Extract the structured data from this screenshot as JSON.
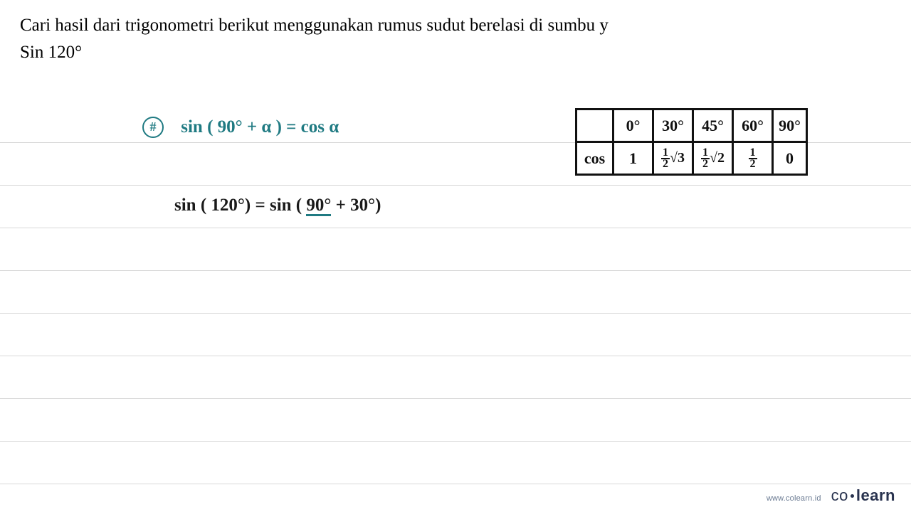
{
  "question": {
    "line1": "Cari hasil dari trigonometri berikut menggunakan rumus sudut berelasi di sumbu y",
    "line2": "Sin 120°"
  },
  "formula": {
    "marker": "#",
    "text": "sin  ( 90° + α )  =  cos  α"
  },
  "calculation": {
    "text_prefix": "sin   ( 120°)   =    sin  ( ",
    "underlined": "90°",
    "text_suffix": " +  30°)"
  },
  "table": {
    "func_label": "cos",
    "headers": [
      "0°",
      "30°",
      "45°",
      "60°",
      "90°"
    ],
    "values": {
      "deg0": "1",
      "deg30": "½√3",
      "deg45": "½√2",
      "deg60": "½",
      "deg90": "0"
    }
  },
  "footer": {
    "url": "www.colearn.id",
    "brand_co": "co",
    "brand_learn": "learn"
  }
}
